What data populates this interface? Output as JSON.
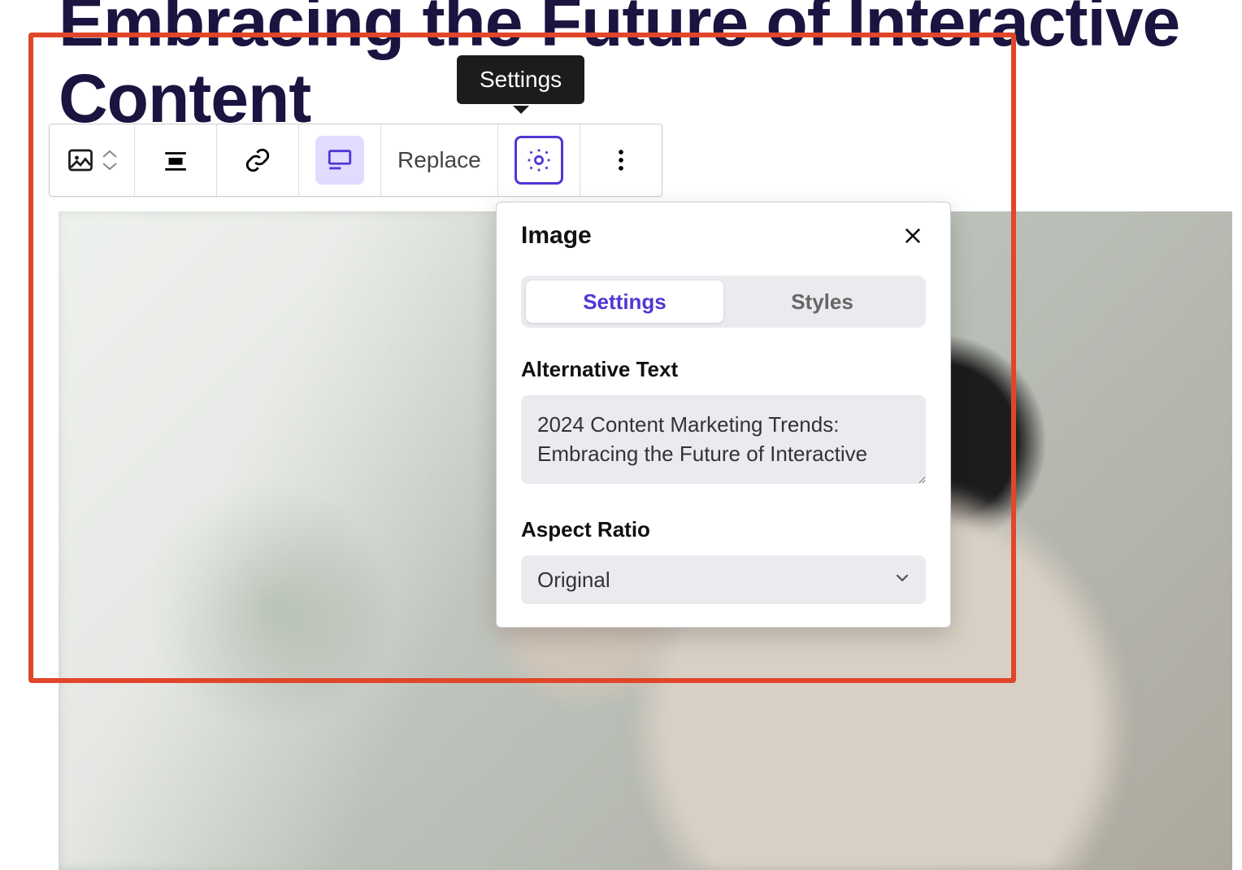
{
  "heading": "Embracing the Future of Interactive Content",
  "tooltip": {
    "settings": "Settings"
  },
  "toolbar": {
    "replace_label": "Replace"
  },
  "panel": {
    "title": "Image",
    "tabs": {
      "settings": "Settings",
      "styles": "Styles"
    },
    "alt_label": "Alternative Text",
    "alt_value": "2024 Content Marketing Trends: Embracing the Future of Interactive",
    "aspect_label": "Aspect Ratio",
    "aspect_value": "Original"
  }
}
